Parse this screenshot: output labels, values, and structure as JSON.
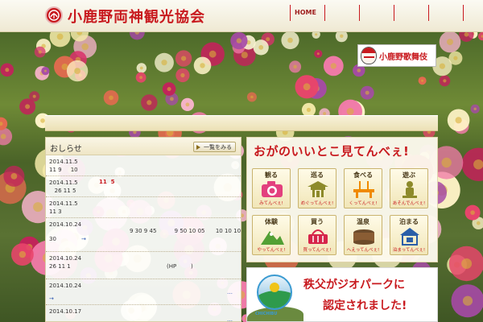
{
  "header": {
    "site_title": "小鹿野両神観光協会",
    "nav": [
      "HOME",
      "",
      "",
      "",
      ""
    ]
  },
  "hero": {
    "kabuki_banner_text": "小鹿野歌舞伎"
  },
  "news": {
    "title": "おしらせ",
    "more_button": "一覧をみる",
    "items": [
      {
        "date": "2014.11.5",
        "text": "11 9     10",
        "red": "",
        "link": "",
        "ellipsis": ""
      },
      {
        "date": "2014.11.5",
        "text": "   26 11 5",
        "red": "11  5",
        "link": "",
        "ellipsis": ""
      },
      {
        "date": "2014.11.5",
        "text": "11 3",
        "red": "",
        "link": "",
        "ellipsis": ""
      },
      {
        "date": "2014.10.24",
        "text": "",
        "red": "",
        "line2": "9 30 9 45          9 50 10 05      10 10 10",
        "line3": "30",
        "link": "→",
        "ellipsis": ""
      },
      {
        "date": "2014.10.24",
        "text": "26 11 1",
        "red": "",
        "line2": "(HP        )",
        "link": "",
        "ellipsis": ""
      },
      {
        "date": "2014.10.24",
        "text": "",
        "red": "",
        "link": "→",
        "ellipsis": "…"
      },
      {
        "date": "2014.10.17",
        "text": "",
        "red": "",
        "link": "",
        "ellipsis": "…"
      }
    ]
  },
  "spots": {
    "title": "おがのいいとこ見てんべぇ!",
    "title_small": "の",
    "buttons": [
      {
        "label": "観る",
        "caption": "みてんべぇ!",
        "icon": "camera-icon"
      },
      {
        "label": "巡る",
        "caption": "めぐってんべぇ!",
        "icon": "temple-icon"
      },
      {
        "label": "食べる",
        "caption": "くってんべぇ!",
        "icon": "dining-icon"
      },
      {
        "label": "遊ぶ",
        "caption": "あそんでんべぇ!",
        "icon": "statue-icon"
      },
      {
        "label": "体験",
        "caption": "やってんべぇ!",
        "icon": "mountain-icon"
      },
      {
        "label": "買う",
        "caption": "買ってんべぇ!",
        "icon": "basket-icon"
      },
      {
        "label": "温泉",
        "caption": "へえってんべぇ!",
        "icon": "onsen-icon"
      },
      {
        "label": "泊まる",
        "caption": "泊まってんべぇ!",
        "icon": "house-icon"
      }
    ],
    "colors": {
      "accent": "#c8191e",
      "icon_pink": "#e3407e",
      "icon_olive": "#8d8a2a",
      "icon_green": "#52a034",
      "icon_blue": "#2b5fa8"
    }
  },
  "geopark": {
    "line1": "秩父がジオパークに",
    "line2": "認定されました!",
    "logo_text": "CHICHIBU"
  },
  "colors": {
    "brand_red": "#c8191e",
    "header_bg": "#f6f2e2",
    "panel_bg": "#fdfaee"
  }
}
